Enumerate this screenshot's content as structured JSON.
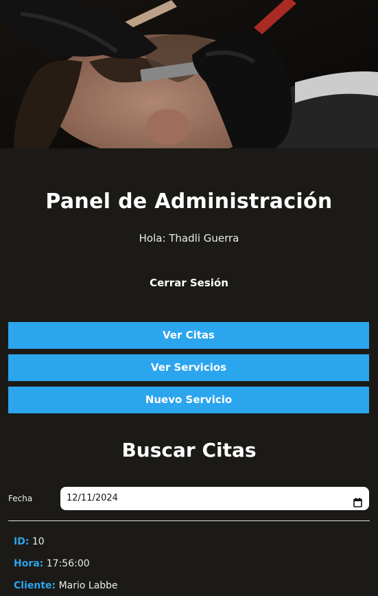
{
  "header": {
    "title": "Panel de Administración",
    "greeting": "Hola: Thadli Guerra",
    "logout_label": "Cerrar Sesión"
  },
  "actions": [
    {
      "label": "Ver Citas"
    },
    {
      "label": "Ver Servicios"
    },
    {
      "label": "Nuevo Servicio"
    }
  ],
  "search": {
    "title": "Buscar Citas",
    "date_label": "Fecha",
    "date_value": "12/11/2024"
  },
  "appointment": {
    "id_label": "ID:",
    "id_value": "10",
    "time_label": "Hora:",
    "time_value": "17:56:00",
    "client_label": "Cliente:",
    "client_value": "Mario Labbe"
  },
  "colors": {
    "background": "#1b1a17",
    "accent": "#2ba5ee",
    "text": "#ffffff"
  },
  "icons": {
    "calendar": "calendar-icon"
  }
}
